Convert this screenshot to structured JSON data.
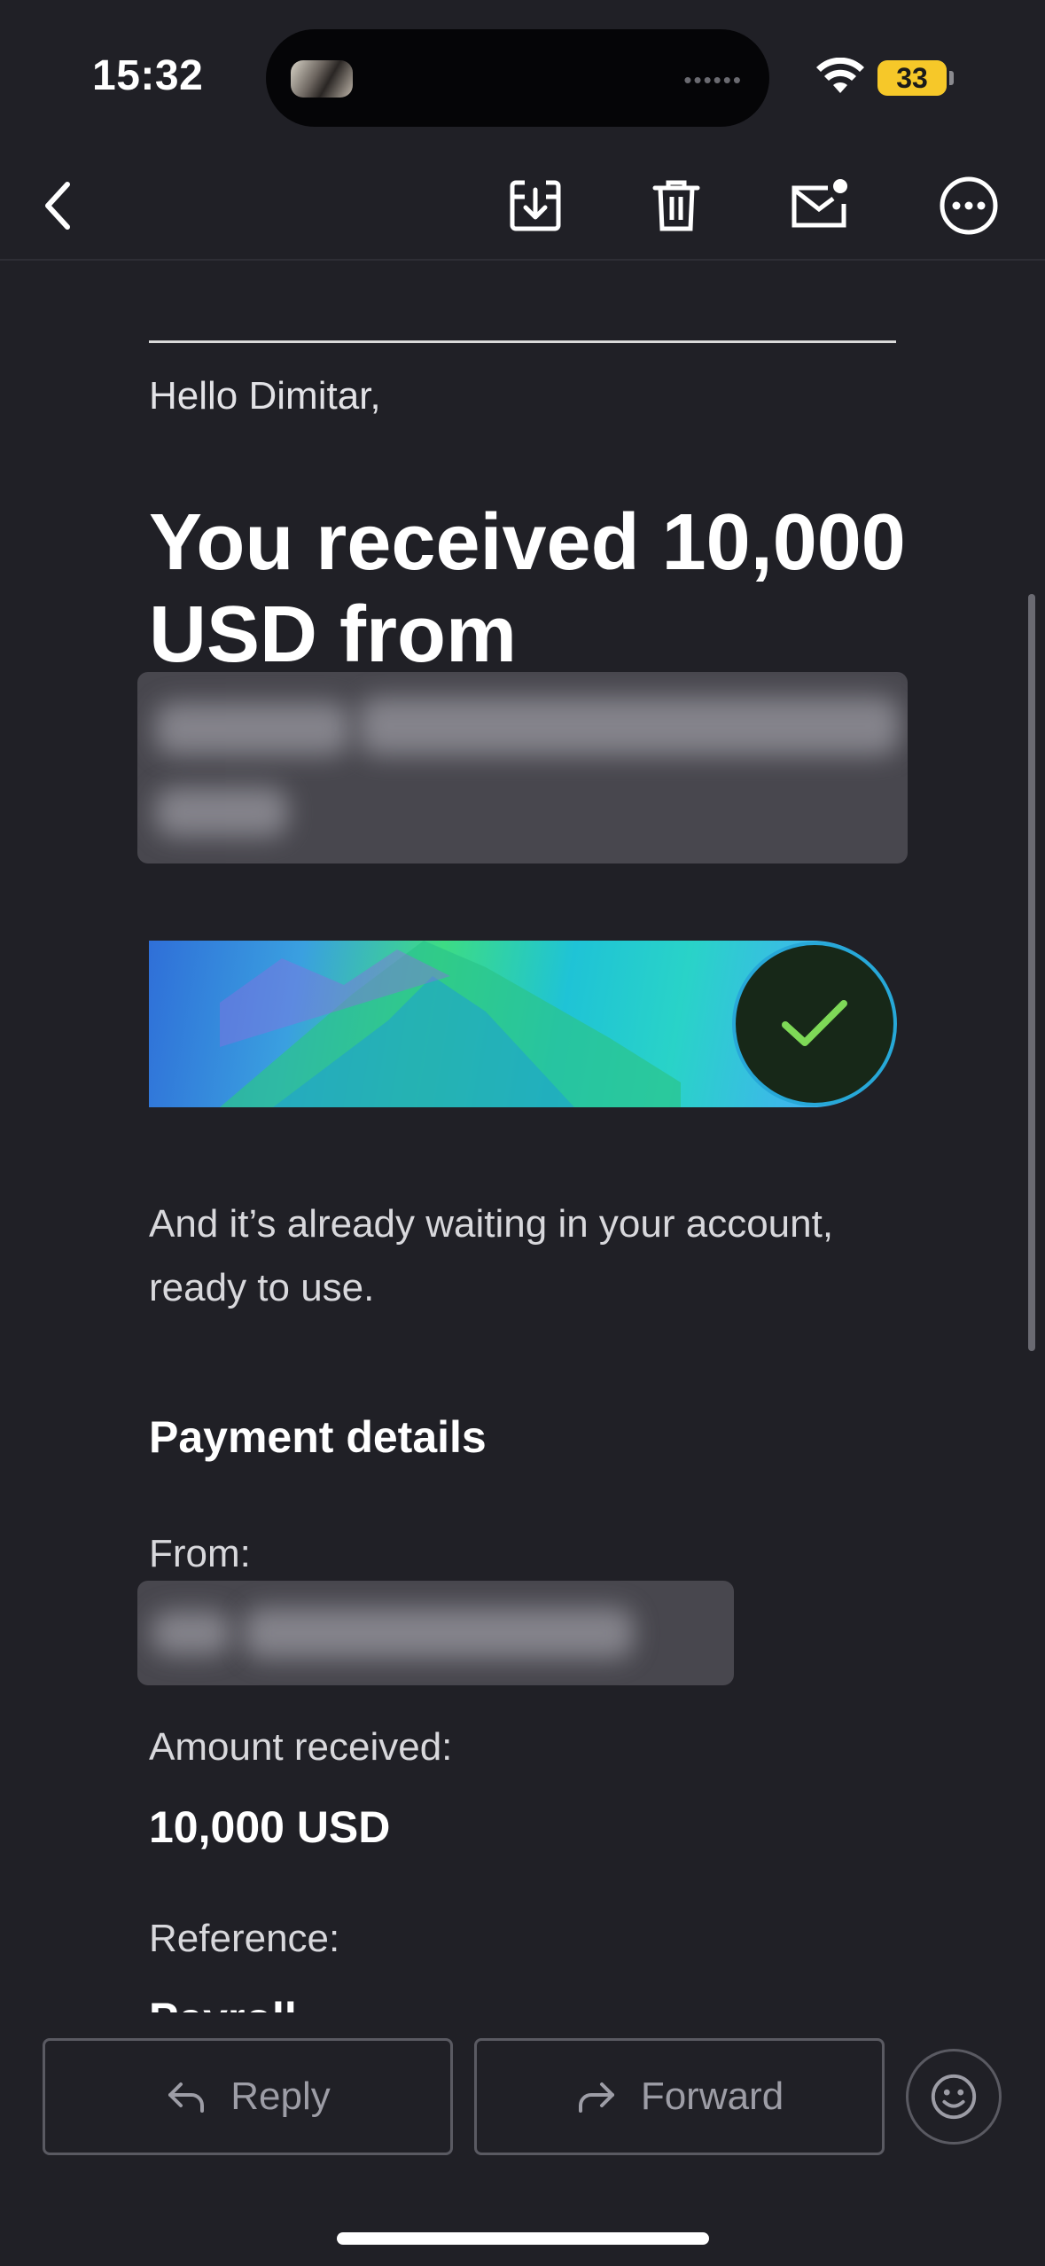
{
  "status_bar": {
    "time": "15:32",
    "battery_level": "33",
    "wifi_icon": "wifi-icon"
  },
  "toolbar": {
    "back_icon": "chevron-left-icon",
    "archive_icon": "archive-download-icon",
    "delete_icon": "trash-icon",
    "mark_unread_icon": "envelope-dot-icon",
    "more_icon": "ellipsis-circle-icon"
  },
  "email": {
    "greeting": "Hello Dimitar,",
    "headline": "You received 10,000 USD from",
    "sender_name_redacted": true,
    "banner_status_icon": "checkmark-icon",
    "body_text": "And it’s already waiting in your account, ready to use.",
    "payment_details": {
      "title": "Payment details",
      "from_label": "From:",
      "from_value_redacted": true,
      "amount_label": "Amount received:",
      "amount_value": "10,000 USD",
      "reference_label": "Reference:",
      "reference_value": "Payroll"
    }
  },
  "actions": {
    "reply_label": "Reply",
    "forward_label": "Forward",
    "reply_icon": "reply-arrow-icon",
    "forward_icon": "forward-arrow-icon",
    "emoji_icon": "smiley-icon"
  },
  "colors": {
    "background": "#202026",
    "text_primary": "#ffffff",
    "text_secondary": "#d8d8dc",
    "check_green": "#7ed957",
    "button_border": "#5a5a62"
  }
}
